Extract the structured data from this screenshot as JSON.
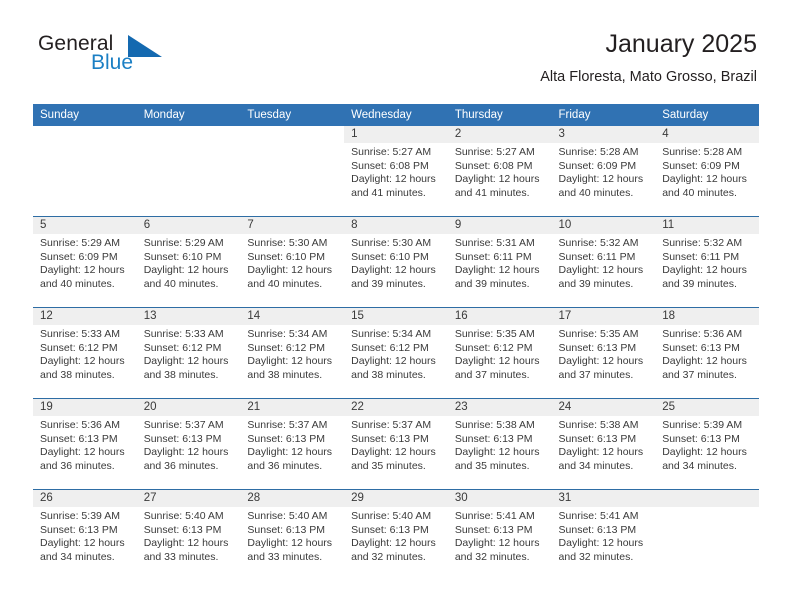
{
  "brand": {
    "word_one": "General",
    "word_two": "Blue",
    "logo_icon": "triangle-logo-icon",
    "accent_color": "#1469b0",
    "blue_text_color": "#1b7fc4"
  },
  "header": {
    "month_title": "January 2025",
    "location": "Alta Floresta, Mato Grosso, Brazil"
  },
  "colors": {
    "header_blue": "#3072b3",
    "row_divider_blue": "#2e6da4",
    "day_band_gray": "#efefef",
    "text": "#3a3a3a"
  },
  "calendar": {
    "weekdays": [
      "Sunday",
      "Monday",
      "Tuesday",
      "Wednesday",
      "Thursday",
      "Friday",
      "Saturday"
    ],
    "weeks": [
      [
        {
          "day": "",
          "sunrise": "",
          "sunset": "",
          "daylight": "",
          "empty": true
        },
        {
          "day": "",
          "sunrise": "",
          "sunset": "",
          "daylight": "",
          "empty": true
        },
        {
          "day": "",
          "sunrise": "",
          "sunset": "",
          "daylight": "",
          "empty": true
        },
        {
          "day": "1",
          "sunrise": "Sunrise: 5:27 AM",
          "sunset": "Sunset: 6:08 PM",
          "daylight": "Daylight: 12 hours and 41 minutes."
        },
        {
          "day": "2",
          "sunrise": "Sunrise: 5:27 AM",
          "sunset": "Sunset: 6:08 PM",
          "daylight": "Daylight: 12 hours and 41 minutes."
        },
        {
          "day": "3",
          "sunrise": "Sunrise: 5:28 AM",
          "sunset": "Sunset: 6:09 PM",
          "daylight": "Daylight: 12 hours and 40 minutes."
        },
        {
          "day": "4",
          "sunrise": "Sunrise: 5:28 AM",
          "sunset": "Sunset: 6:09 PM",
          "daylight": "Daylight: 12 hours and 40 minutes."
        }
      ],
      [
        {
          "day": "5",
          "sunrise": "Sunrise: 5:29 AM",
          "sunset": "Sunset: 6:09 PM",
          "daylight": "Daylight: 12 hours and 40 minutes."
        },
        {
          "day": "6",
          "sunrise": "Sunrise: 5:29 AM",
          "sunset": "Sunset: 6:10 PM",
          "daylight": "Daylight: 12 hours and 40 minutes."
        },
        {
          "day": "7",
          "sunrise": "Sunrise: 5:30 AM",
          "sunset": "Sunset: 6:10 PM",
          "daylight": "Daylight: 12 hours and 40 minutes."
        },
        {
          "day": "8",
          "sunrise": "Sunrise: 5:30 AM",
          "sunset": "Sunset: 6:10 PM",
          "daylight": "Daylight: 12 hours and 39 minutes."
        },
        {
          "day": "9",
          "sunrise": "Sunrise: 5:31 AM",
          "sunset": "Sunset: 6:11 PM",
          "daylight": "Daylight: 12 hours and 39 minutes."
        },
        {
          "day": "10",
          "sunrise": "Sunrise: 5:32 AM",
          "sunset": "Sunset: 6:11 PM",
          "daylight": "Daylight: 12 hours and 39 minutes."
        },
        {
          "day": "11",
          "sunrise": "Sunrise: 5:32 AM",
          "sunset": "Sunset: 6:11 PM",
          "daylight": "Daylight: 12 hours and 39 minutes."
        }
      ],
      [
        {
          "day": "12",
          "sunrise": "Sunrise: 5:33 AM",
          "sunset": "Sunset: 6:12 PM",
          "daylight": "Daylight: 12 hours and 38 minutes."
        },
        {
          "day": "13",
          "sunrise": "Sunrise: 5:33 AM",
          "sunset": "Sunset: 6:12 PM",
          "daylight": "Daylight: 12 hours and 38 minutes."
        },
        {
          "day": "14",
          "sunrise": "Sunrise: 5:34 AM",
          "sunset": "Sunset: 6:12 PM",
          "daylight": "Daylight: 12 hours and 38 minutes."
        },
        {
          "day": "15",
          "sunrise": "Sunrise: 5:34 AM",
          "sunset": "Sunset: 6:12 PM",
          "daylight": "Daylight: 12 hours and 38 minutes."
        },
        {
          "day": "16",
          "sunrise": "Sunrise: 5:35 AM",
          "sunset": "Sunset: 6:12 PM",
          "daylight": "Daylight: 12 hours and 37 minutes."
        },
        {
          "day": "17",
          "sunrise": "Sunrise: 5:35 AM",
          "sunset": "Sunset: 6:13 PM",
          "daylight": "Daylight: 12 hours and 37 minutes."
        },
        {
          "day": "18",
          "sunrise": "Sunrise: 5:36 AM",
          "sunset": "Sunset: 6:13 PM",
          "daylight": "Daylight: 12 hours and 37 minutes."
        }
      ],
      [
        {
          "day": "19",
          "sunrise": "Sunrise: 5:36 AM",
          "sunset": "Sunset: 6:13 PM",
          "daylight": "Daylight: 12 hours and 36 minutes."
        },
        {
          "day": "20",
          "sunrise": "Sunrise: 5:37 AM",
          "sunset": "Sunset: 6:13 PM",
          "daylight": "Daylight: 12 hours and 36 minutes."
        },
        {
          "day": "21",
          "sunrise": "Sunrise: 5:37 AM",
          "sunset": "Sunset: 6:13 PM",
          "daylight": "Daylight: 12 hours and 36 minutes."
        },
        {
          "day": "22",
          "sunrise": "Sunrise: 5:37 AM",
          "sunset": "Sunset: 6:13 PM",
          "daylight": "Daylight: 12 hours and 35 minutes."
        },
        {
          "day": "23",
          "sunrise": "Sunrise: 5:38 AM",
          "sunset": "Sunset: 6:13 PM",
          "daylight": "Daylight: 12 hours and 35 minutes."
        },
        {
          "day": "24",
          "sunrise": "Sunrise: 5:38 AM",
          "sunset": "Sunset: 6:13 PM",
          "daylight": "Daylight: 12 hours and 34 minutes."
        },
        {
          "day": "25",
          "sunrise": "Sunrise: 5:39 AM",
          "sunset": "Sunset: 6:13 PM",
          "daylight": "Daylight: 12 hours and 34 minutes."
        }
      ],
      [
        {
          "day": "26",
          "sunrise": "Sunrise: 5:39 AM",
          "sunset": "Sunset: 6:13 PM",
          "daylight": "Daylight: 12 hours and 34 minutes."
        },
        {
          "day": "27",
          "sunrise": "Sunrise: 5:40 AM",
          "sunset": "Sunset: 6:13 PM",
          "daylight": "Daylight: 12 hours and 33 minutes."
        },
        {
          "day": "28",
          "sunrise": "Sunrise: 5:40 AM",
          "sunset": "Sunset: 6:13 PM",
          "daylight": "Daylight: 12 hours and 33 minutes."
        },
        {
          "day": "29",
          "sunrise": "Sunrise: 5:40 AM",
          "sunset": "Sunset: 6:13 PM",
          "daylight": "Daylight: 12 hours and 32 minutes."
        },
        {
          "day": "30",
          "sunrise": "Sunrise: 5:41 AM",
          "sunset": "Sunset: 6:13 PM",
          "daylight": "Daylight: 12 hours and 32 minutes."
        },
        {
          "day": "31",
          "sunrise": "Sunrise: 5:41 AM",
          "sunset": "Sunset: 6:13 PM",
          "daylight": "Daylight: 12 hours and 32 minutes."
        },
        {
          "day": "",
          "sunrise": "",
          "sunset": "",
          "daylight": "",
          "trailing_blank": true
        }
      ]
    ]
  }
}
